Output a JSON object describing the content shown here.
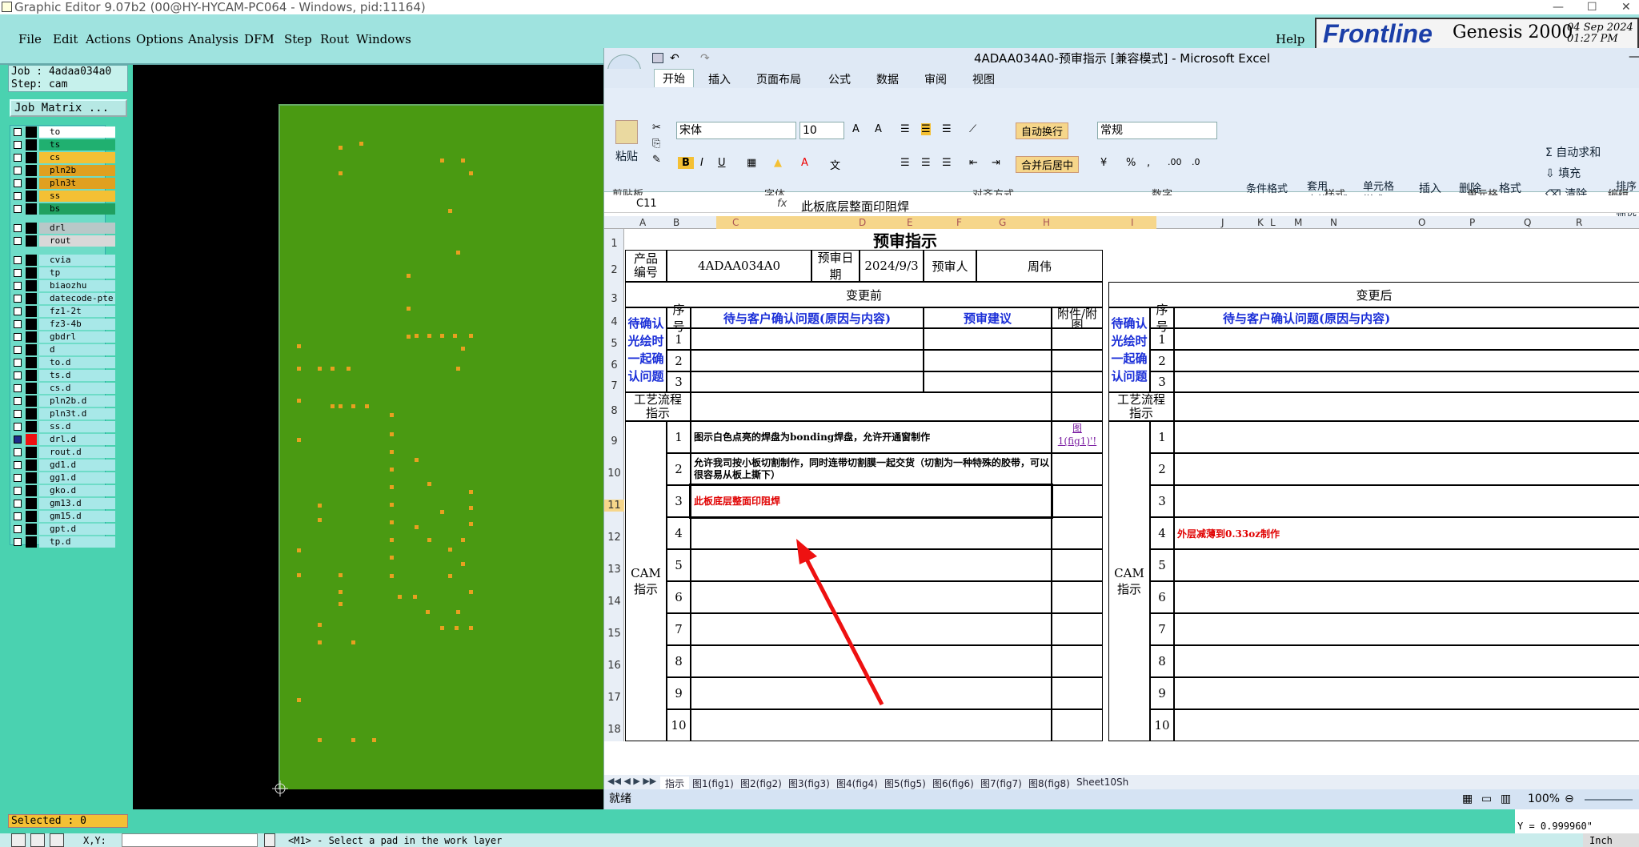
{
  "genesis": {
    "title": "Graphic Editor 9.07b2 (00@HY-HYCAM-PC064 - Windows, pid:11164)",
    "menus": [
      "File",
      "Edit",
      "Actions",
      "Options",
      "Analysis",
      "DFM",
      "Step",
      "Rout",
      "Windows"
    ],
    "help": "Help",
    "logo": {
      "brand": "Frontline",
      "product": "Genesis 2000",
      "date": "04 Sep 2024",
      "time": "01:27 PM"
    },
    "job": "Job : 4adaa034a0",
    "step": "Step: cam",
    "job_matrix": "Job Matrix ...",
    "layers": [
      {
        "name": "to",
        "color": "#ffffff"
      },
      {
        "name": "ts",
        "color": "#20b070"
      },
      {
        "name": "cs",
        "color": "#f4c034"
      },
      {
        "name": "pln2b",
        "color": "#e0a020"
      },
      {
        "name": "pln3t",
        "color": "#e0a020"
      },
      {
        "name": "ss",
        "color": "#f4c034"
      },
      {
        "name": "bs",
        "color": "#20a060"
      },
      {
        "name": "drl",
        "color": "#b8c8c8"
      },
      {
        "name": "rout",
        "color": "#d8d8d8"
      },
      {
        "name": "cvia",
        "color": "#a8e8e8"
      },
      {
        "name": "tp",
        "color": "#a8e8e8"
      },
      {
        "name": "biaozhu",
        "color": "#a8e8e8"
      },
      {
        "name": "datecode-pte",
        "color": "#a8e8e8"
      },
      {
        "name": "fz1-2t",
        "color": "#a8e8e8"
      },
      {
        "name": "fz3-4b",
        "color": "#a8e8e8"
      },
      {
        "name": "gbdrl",
        "color": "#a8e8e8"
      },
      {
        "name": "d",
        "color": "#a8e8e8"
      },
      {
        "name": "to.d",
        "color": "#a8e8e8"
      },
      {
        "name": "ts.d",
        "color": "#a8e8e8"
      },
      {
        "name": "cs.d",
        "color": "#a8e8e8"
      },
      {
        "name": "pln2b.d",
        "color": "#a8e8e8"
      },
      {
        "name": "pln3t.d",
        "color": "#a8e8e8"
      },
      {
        "name": "ss.d",
        "color": "#a8e8e8"
      },
      {
        "name": "drl.d",
        "color": "#a8e8e8"
      },
      {
        "name": "rout.d",
        "color": "#a8e8e8"
      },
      {
        "name": "gd1.d",
        "color": "#a8e8e8"
      },
      {
        "name": "gg1.d",
        "color": "#a8e8e8"
      },
      {
        "name": "gko.d",
        "color": "#a8e8e8"
      },
      {
        "name": "gm13.d",
        "color": "#a8e8e8"
      },
      {
        "name": "gm15.d",
        "color": "#a8e8e8"
      },
      {
        "name": "gpt.d",
        "color": "#a8e8e8"
      },
      {
        "name": "tp.d",
        "color": "#a8e8e8"
      }
    ],
    "selected": "Selected : 0",
    "status_xy": "X,Y:",
    "status_msg": "<M1> - Select a pad in the work layer",
    "y_readout": "Y = 0.999960\"",
    "unit": "Inch"
  },
  "excel": {
    "title": "4ADAA034A0-预审指示 [兼容模式] - Microsoft Excel",
    "tabs": [
      "开始",
      "插入",
      "页面布局",
      "公式",
      "数据",
      "审阅",
      "视图"
    ],
    "ribbon": {
      "paste": "粘贴",
      "font_name": "宋体",
      "font_size": "10",
      "wrap": "自动换行",
      "merge": "合并后居中",
      "number_format": "常规",
      "cond_format": "条件格式",
      "table_format": "套用\n表格格式",
      "cell_style": "单元格\n样式",
      "insert": "插入",
      "delete": "删除",
      "format": "格式",
      "autosum": "自动求和",
      "fill": "填充",
      "clear": "清除",
      "sort": "排序和\n筛选",
      "groups": [
        "剪贴板",
        "字体",
        "对齐方式",
        "数字",
        "样式",
        "单元格",
        "编辑"
      ]
    },
    "name_box": "C11",
    "fx": "fx",
    "formula": "此板底层整面印阻焊",
    "columns": [
      "A",
      "B",
      "C",
      "D",
      "E",
      "F",
      "G",
      "H",
      "I",
      "J",
      "K",
      "L",
      "M",
      "N",
      "O",
      "P",
      "Q",
      "R"
    ],
    "rows": [
      "1",
      "2",
      "3",
      "4",
      "5",
      "6",
      "7",
      "8",
      "9",
      "10",
      "11",
      "12",
      "13",
      "14",
      "15",
      "16",
      "17",
      "18"
    ],
    "sheet": {
      "title": "预审指示",
      "product_no_label": "产品\n编号",
      "product_no": "4ADAA034A0",
      "date_label": "预审日期",
      "date": "2024/9/3",
      "reviewer_label": "预审人",
      "reviewer": "周伟",
      "before": "变更前",
      "after": "变更后",
      "seq": "序号",
      "issue_header": "待与客户确认问题(原因与内容)",
      "suggest_header": "预审建议",
      "attach_header": "附件/附\n图",
      "confirm_label": "待确认\n光绘时\n一起确\n认问题",
      "process_label": "工艺流程\n指示",
      "cam_label": "CAM\n指示",
      "seq_1_3": [
        "1",
        "2",
        "3"
      ],
      "cam_seq": [
        "1",
        "2",
        "3",
        "4",
        "5",
        "6",
        "7",
        "8",
        "9",
        "10"
      ],
      "cam_items": [
        "图示白色点亮的焊盘为bonding焊盘，允许开通窗制作",
        "允许我司按小板切割制作，同时连带切割膜一起交货（切割为一种特殊的胶带，可以很容易从板上撕下）",
        "此板底层整面印阻焊"
      ],
      "attach_link": "图\n1(fig1)'!",
      "right_cam_4": "外层减薄到0.33oz制作"
    },
    "sheet_tabs": [
      "指示",
      "图1(fig1)",
      "图2(fig2)",
      "图3(fig3)",
      "图4(fig4)",
      "图5(fig5)",
      "图6(fig6)",
      "图7(fig7)",
      "图8(fig8)",
      "Sheet10",
      "Sh"
    ],
    "status": "就绪",
    "zoom": "100%"
  }
}
